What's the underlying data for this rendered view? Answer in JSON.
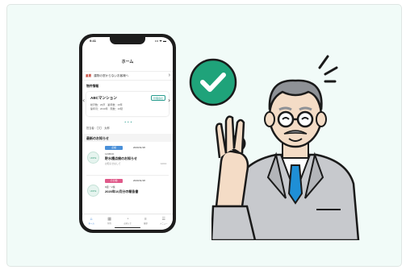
{
  "phone": {
    "status_time": "9:41",
    "status_signal": "••• ᯤ ▬",
    "title": "ホーム",
    "notice": {
      "tag": "重要",
      "text": "建物の窓からないお客様へ"
    },
    "property_section": "物件情報",
    "property": {
      "name": "ABCマンション",
      "badge": "管理会社",
      "line1": "総戸数：20戸　築年数：10年",
      "line2": "築年月：2010年　階数：10階",
      "dots": "• • •"
    },
    "manager": "担当者：〇〇　太郎",
    "news_section": "最新のお知らせ",
    "news": [
      {
        "category": "点検",
        "category_color": "#4a90d9",
        "date": "2020/11/18",
        "logo": "UNITE",
        "org": "123BCD",
        "title": "貯水槽点検のお知らせ",
        "note": "お知らせなしで",
        "count": "12/13"
      },
      {
        "category": "その他",
        "category_color": "#e05a8a",
        "date": "2020/11/18",
        "logo": "UNITE",
        "org": "Ⅱ組・Ⅴ棟",
        "title": "2020年10月分の報告書",
        "note": "",
        "count": ""
      }
    ],
    "tabs": [
      {
        "label": "ホーム",
        "icon": "⌂"
      },
      {
        "label": "物件",
        "icon": "▦"
      },
      {
        "label": "お知らせ",
        "icon": "◔"
      },
      {
        "label": "履歴",
        "icon": "≡"
      },
      {
        "label": "メニュー",
        "icon": "☰"
      }
    ]
  },
  "colors": {
    "background": "#f1fbf8",
    "check_circle": "#1fa37a",
    "suit": "#c7c9cd",
    "tie": "#1f8fd6"
  }
}
